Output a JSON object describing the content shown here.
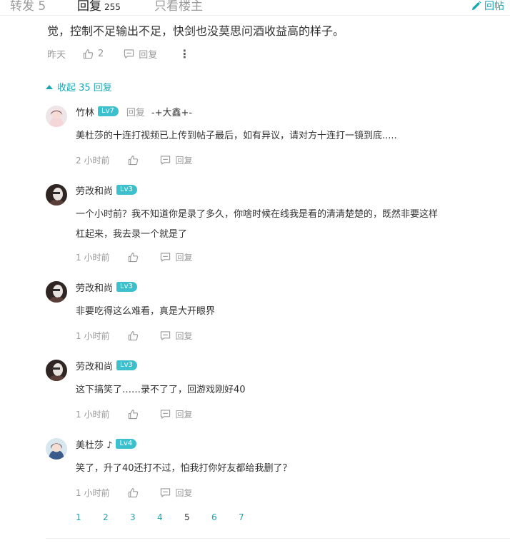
{
  "tabs": {
    "repost": "转发 5",
    "reply_label": "回复",
    "reply_count": "255",
    "owner_only": "只看楼主",
    "reply_post": "回帖"
  },
  "main": {
    "text": "觉，控制不足输出不足，快剑也没莫思问酒收益高的样子。",
    "time": "昨天",
    "likes": "2",
    "reply_label": "回复",
    "more": "⋮"
  },
  "collapse": {
    "label": "收起 35 回复"
  },
  "replies": [
    {
      "user": "竹林",
      "level": "Lv7",
      "reply_to_label": "回复",
      "reply_to": "-+大鑫+-",
      "lines": [
        "美杜莎的十连打视频已上传到帖子最后，如有异议，请对方十连打一镜到底....."
      ],
      "time": "2 小时前",
      "reply_label": "回复"
    },
    {
      "user": "劳改和尚",
      "level": "Lv3",
      "lines": [
        "一个小时前？我不知道你是录了多久，你啥时候在线我是看的清清楚楚的，既然非要这样",
        "杠起来，我去录一个就是了"
      ],
      "time": "1 小时前",
      "reply_label": "回复"
    },
    {
      "user": "劳改和尚",
      "level": "Lv3",
      "lines": [
        "非要吃得这么难看，真是大开眼界"
      ],
      "time": "1 小时前",
      "reply_label": "回复"
    },
    {
      "user": "劳改和尚",
      "level": "Lv3",
      "lines": [
        "这下搞笑了……录不了了，回游戏刚好40"
      ],
      "time": "1 小时前",
      "reply_label": "回复"
    },
    {
      "user": "美杜莎 ♪",
      "level": "Lv4",
      "lines": [
        "笑了，升了40还打不过，怕我打你好友都给我删了？"
      ],
      "time": "1 小时前",
      "reply_label": "回复"
    }
  ],
  "pagination": {
    "pages": [
      "1",
      "2",
      "3",
      "4",
      "5",
      "6",
      "7"
    ],
    "current": "5"
  },
  "colors": {
    "accent": "#1aa7b3",
    "level_badge": "#3cc0cd",
    "muted": "#999999"
  }
}
